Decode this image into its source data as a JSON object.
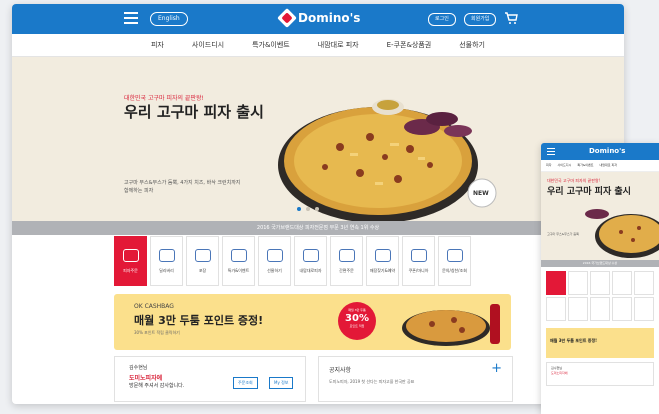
{
  "header": {
    "language_label": "English",
    "brand": "Domino's",
    "login_label": "로그인",
    "signup_label": "회원가입"
  },
  "nav": {
    "items": [
      "피자",
      "사이드디시",
      "특가&이벤트",
      "내맘대로 피자",
      "E-쿠폰&상품권",
      "선물하기"
    ]
  },
  "hero": {
    "kicker": "대한민국 고구마 피자의 끝판왕!",
    "title": "우리 고구마 피자 출시",
    "description": "고구마 무스&무스가 듬뿍, 4가지 치즈, 바삭 크런치까지 함께하는 피자",
    "new_label": "NEW"
  },
  "notice_bar": "2016 국가브랜드대상 피자전문점 부문 3년 연속 1위 수상",
  "quick_menu": [
    {
      "label": "피자주문",
      "icon": "pizza-icon"
    },
    {
      "label": "딜리버리",
      "icon": "delivery-icon"
    },
    {
      "label": "포장",
      "icon": "takeout-icon"
    },
    {
      "label": "특가&이벤트",
      "icon": "event-icon"
    },
    {
      "label": "선물하기",
      "icon": "gift-icon"
    },
    {
      "label": "내맘대로피자",
      "icon": "custom-pizza-icon"
    },
    {
      "label": "간편주문",
      "icon": "quick-order-icon"
    },
    {
      "label": "매장찾기&예약",
      "icon": "store-icon"
    },
    {
      "label": "쿠폰/마니아",
      "icon": "coupon-icon"
    },
    {
      "label": "문의/칭찬/조회",
      "icon": "inquiry-icon"
    }
  ],
  "promo": {
    "sub": "OK CASHBAG",
    "title": "매월 3만 두툼 포인트 증정!",
    "note": "30% 포인트 적립 클릭하기",
    "badge_top": "매월 3만 두툼",
    "badge_pct": "30%",
    "badge_bottom": "포인트 적립"
  },
  "welcome": {
    "greeting": "김수현님",
    "highlight": "도미노피자에",
    "line": "방문해 주셔서 감사합니다.",
    "btn_orders": "주문조회",
    "btn_my": "My 정보"
  },
  "notice_box": {
    "title": "공지사항",
    "item": "도미노피자, 2019 첫 선다는 피자고을 한국판 공표"
  },
  "mobile": {
    "brand": "Domino's",
    "nav": [
      "피자",
      "사이드디시",
      "특가&이벤트",
      "내맘대로 피자"
    ],
    "kicker": "대한민국 고구마 피자의 끝판왕!",
    "title": "우리 고구마 피자 출시",
    "desc": "고구마 무스&무스가 듬뿍",
    "notice": "2016 국가브랜드대상 수상",
    "promo": "매월 3만 두툼 포인트 증정!",
    "welcome_1": "김수현님",
    "welcome_2": "도미노피자에"
  },
  "colors": {
    "brand_blue": "#1a79c9",
    "brand_red": "#e31837",
    "hero_bg": "#f2ecdf",
    "promo_bg": "#fbe08c"
  }
}
